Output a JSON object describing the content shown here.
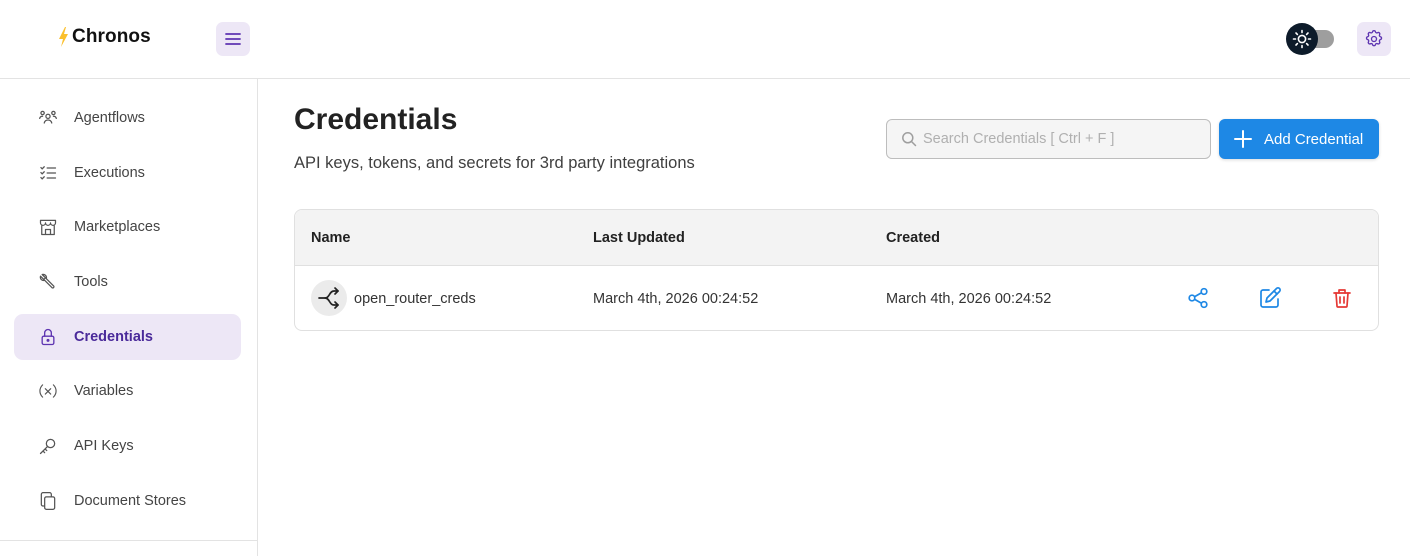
{
  "app": {
    "name": "Chronos",
    "brand_color": "#fbc02d",
    "accent_color": "#1e88e5",
    "active_nav_bg": "#ede7f6"
  },
  "header": {
    "menu_icon": "hamburger-icon",
    "theme_icon": "sun-icon",
    "settings_icon": "gear-icon"
  },
  "sidebar": {
    "items": [
      {
        "label": "Agentflows",
        "icon": "users-icon",
        "active": false
      },
      {
        "label": "Executions",
        "icon": "checklist-icon",
        "active": false
      },
      {
        "label": "Marketplaces",
        "icon": "storefront-icon",
        "active": false
      },
      {
        "label": "Tools",
        "icon": "wrench-icon",
        "active": false
      },
      {
        "label": "Credentials",
        "icon": "lock-icon",
        "active": true
      },
      {
        "label": "Variables",
        "icon": "variable-icon",
        "active": false
      },
      {
        "label": "API Keys",
        "icon": "key-icon",
        "active": false
      },
      {
        "label": "Document Stores",
        "icon": "documents-icon",
        "active": false
      }
    ]
  },
  "main": {
    "title": "Credentials",
    "subtitle": "API keys, tokens, and secrets for 3rd party integrations",
    "search": {
      "placeholder": "Search Credentials [ Ctrl + F ]",
      "value": ""
    },
    "add_button_label": "Add Credential",
    "table": {
      "columns": [
        "Name",
        "Last Updated",
        "Created"
      ],
      "rows": [
        {
          "name": "open_router_creds",
          "icon": "router-icon",
          "last_updated": "March 4th, 2026 00:24:52",
          "created": "March 4th, 2026 00:24:52",
          "actions": [
            "share-icon",
            "edit-icon",
            "delete-icon"
          ]
        }
      ]
    }
  }
}
